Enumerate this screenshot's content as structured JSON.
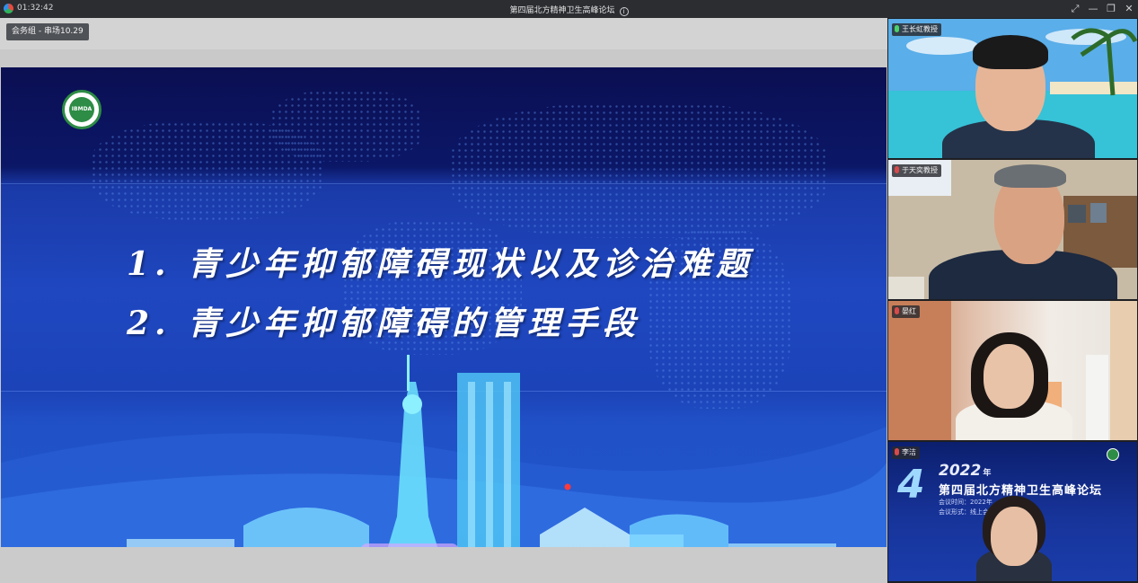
{
  "titlebar": {
    "timer": "01:32:42",
    "title": "第四届北方精神卫生高峰论坛",
    "info_icon": "i"
  },
  "window_controls": {
    "fullscreen": "⤢",
    "minimize": "—",
    "restore": "❐",
    "close": "✕"
  },
  "main": {
    "room_label": "会务组 - 串场10.29"
  },
  "slide": {
    "logo_text": "IBMDA",
    "line1": "1. 青少年抑郁障碍现状以及诊治难题",
    "line2": "2. 青少年抑郁障碍的管理手段"
  },
  "participants": [
    {
      "name": "王长虹教授",
      "mic": "on"
    },
    {
      "name": "于天奕教授",
      "mic": "off"
    },
    {
      "name": "晏红",
      "mic": "off"
    },
    {
      "name": "李洁",
      "mic": "off"
    }
  ],
  "banner": {
    "big_number": "4",
    "year": "2022",
    "year_suffix": "年",
    "title": "第四届北方精神卫生高峰论坛",
    "time_line": "会议时间：2022年",
    "form_line": "会议形式：线上会"
  },
  "colors": {
    "slide_dark": "#0b1767",
    "slide_blue": "#1f47c0",
    "mic_on": "#4ad36a",
    "mic_off": "#d84a4a"
  }
}
